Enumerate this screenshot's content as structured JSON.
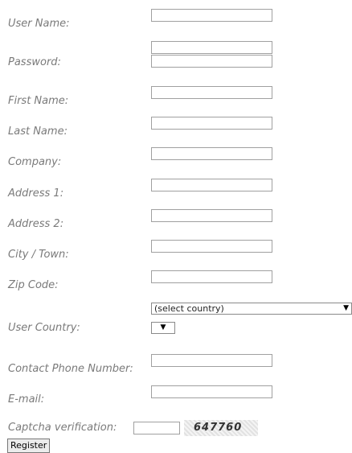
{
  "form": {
    "username_label": "User Name:",
    "password_label": "Password:",
    "first_name_label": "First Name:",
    "last_name_label": "Last Name:",
    "company_label": "Company:",
    "address1_label": "Address 1:",
    "address2_label": "Address 2:",
    "city_label": "City / Town:",
    "zip_label": "Zip Code:",
    "country_label": "User Country:",
    "country_selected": "(select country)",
    "phone_label": "Contact Phone Number:",
    "email_label": "E-mail:",
    "captcha_label": "Captcha verification:",
    "captcha_code": "647760",
    "register_label": "Register"
  },
  "icons": {
    "dropdown_arrow": "dropdown-arrow-icon"
  }
}
